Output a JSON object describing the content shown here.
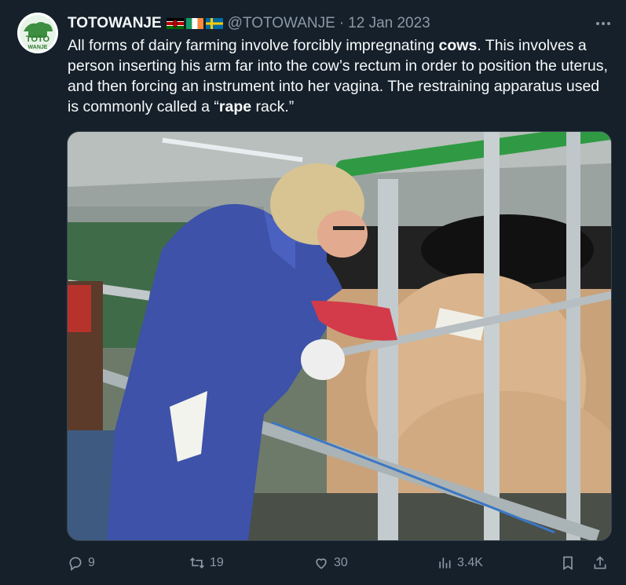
{
  "tweet": {
    "display_name": "TOTOWANJE",
    "handle": "@TOTOWANJE",
    "separator": "·",
    "date": "12 Jan 2023",
    "flags": [
      "kenya-flag",
      "ireland-flag",
      "sweden-flag"
    ],
    "avatar_text": "TOTO WANJE",
    "text": {
      "p1": "All forms of dairy farming involve forcibly impregnating ",
      "b1": "cows",
      "p2": ". This involves a person inserting his arm far into the cow’s rectum in order to position the uterus, and then forcing an instrument into her vagina. The restraining apparatus used is commonly called a ",
      "q_open": "“",
      "b2": "rape",
      "p3": " rack.”"
    }
  },
  "stats": {
    "replies": "9",
    "retweets": "19",
    "likes": "30",
    "views": "3.4K"
  },
  "icons": {
    "reply": "reply-icon",
    "retweet": "retweet-icon",
    "like": "heart-icon",
    "views": "views-icon",
    "bookmark": "bookmark-icon",
    "share": "share-icon",
    "more": "more-icon"
  },
  "colors": {
    "background": "#15202b",
    "text": "#f7f9f9",
    "secondary": "#8b98a5"
  }
}
